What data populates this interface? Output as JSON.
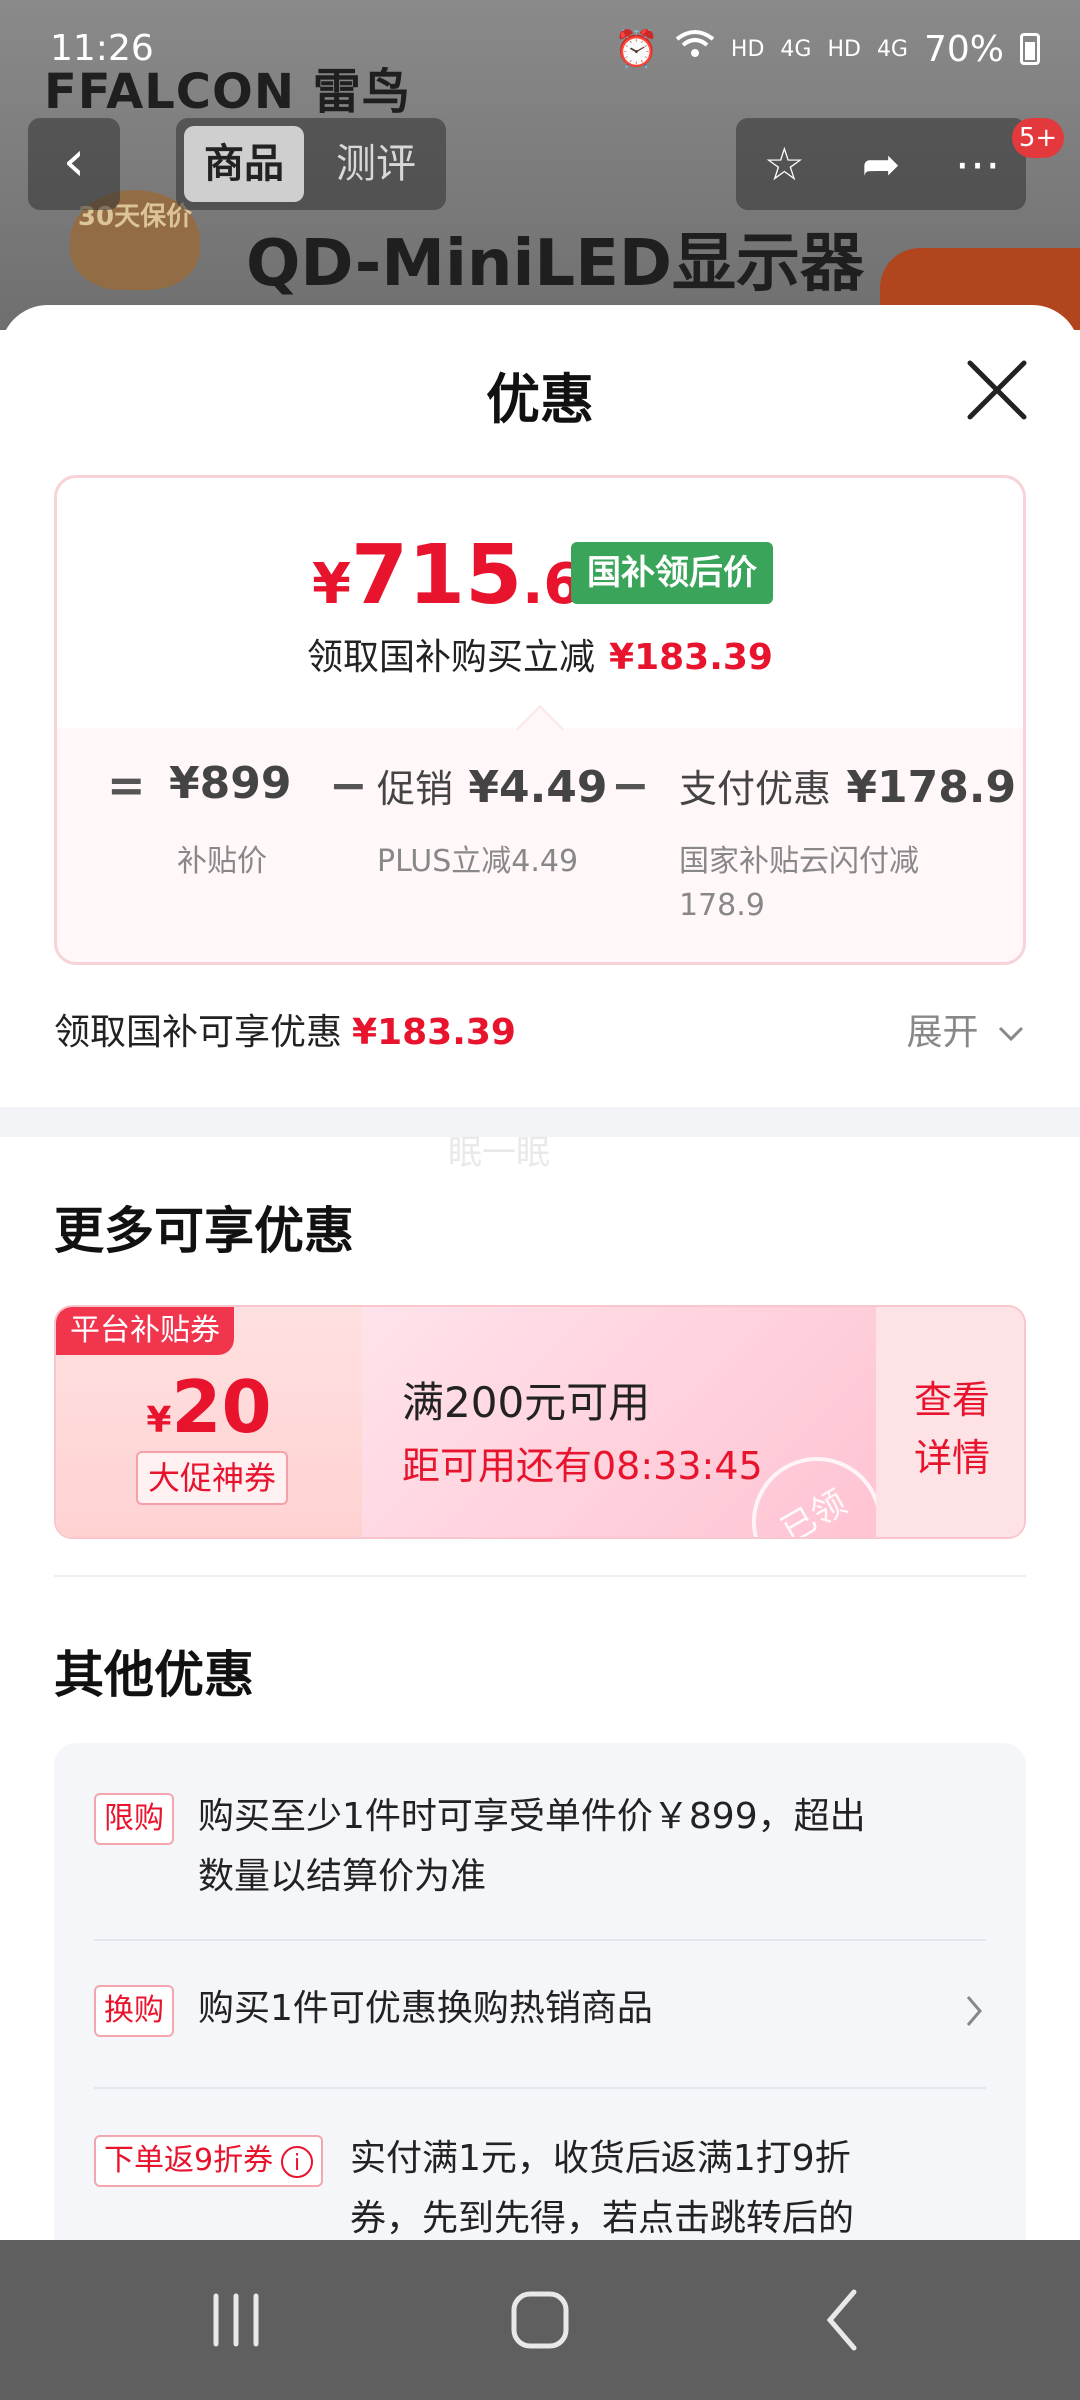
{
  "status_bar": {
    "time": "11:26",
    "network_hd_1": "HD",
    "network_4g_1": "4G",
    "network_hd_2": "HD",
    "network_4g_2": "4G",
    "battery": "70%"
  },
  "background_page": {
    "brand": "FFALCON 雷鸟",
    "badge_text": "30天保价",
    "product_title": "QD-MiniLED显示器"
  },
  "top_nav": {
    "tabs": [
      "商品",
      "测评"
    ],
    "message_badge": "5+"
  },
  "sheet": {
    "title": "优惠",
    "price_card": {
      "final_price_yen": "¥",
      "final_price_int": "715",
      "final_price_dec": ".61",
      "price_tag": "国补领后价",
      "saving_label": "领取国补购买立减",
      "saving_amount": "¥183.39",
      "formula": {
        "equals": "=",
        "base_value": "¥899",
        "base_label": "补贴价",
        "minus_1": "−",
        "promo_label": "促销",
        "promo_value": "¥4.49",
        "promo_sub": "PLUS立减4.49",
        "minus_2": "−",
        "pay_label": "支付优惠",
        "pay_value": "¥178.9",
        "pay_sub_line1": "国家补贴云闪付减",
        "pay_sub_line2": "178.9"
      }
    },
    "discount_row": {
      "label": "领取国补可享优惠",
      "amount": "¥183.39",
      "expand": "展开"
    },
    "watermark": "眠一眠",
    "more_section": {
      "title": "更多可享优惠",
      "coupon": {
        "badge": "平台补贴券",
        "currency": "¥",
        "amount": "20",
        "name": "大促神券",
        "condition": "满200元可用",
        "countdown": "距可用还有08:33:45",
        "stamp": "已领",
        "detail_line1": "查看",
        "detail_line2": "详情"
      }
    },
    "other_section": {
      "title": "其他优惠",
      "items": [
        {
          "tag": "限购",
          "line1": "购买至少1件时可享受单件价￥899，超出",
          "line2": "数量以结算价为准"
        },
        {
          "tag": "换购",
          "line1": "购买1件可优惠换购热销商品"
        },
        {
          "tag": "下单返9折券",
          "line1": "实付满1元，收货后返满1打9折",
          "line2": "券，先到先得，若点击跳转后的"
        }
      ]
    }
  },
  "colors": {
    "accent_red": "#e8132d",
    "tag_green": "#3aa55a",
    "system_nav": "#5f5f5f"
  }
}
